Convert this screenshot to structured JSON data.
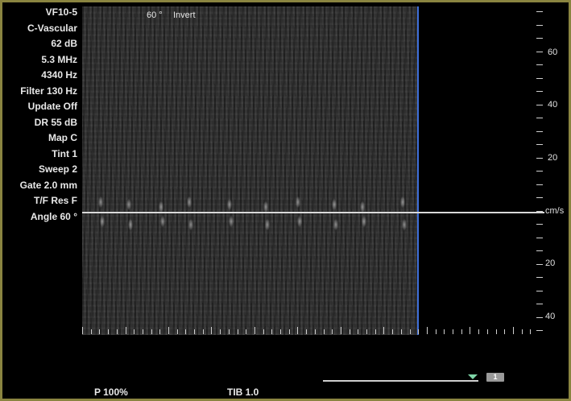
{
  "params": [
    "VF10-5",
    "C-Vascular",
    "62 dB",
    "5.3 MHz",
    "4340 Hz",
    "Filter 130 Hz",
    "Update Off",
    "DR 55 dB",
    "Map C",
    "Tint 1",
    "Sweep 2",
    "Gate 2.0 mm",
    "T/F Res F",
    "Angle 60 °"
  ],
  "overlay": {
    "angle": "60 °",
    "invert": "Invert"
  },
  "scale": {
    "labels": [
      "60",
      "40",
      "20",
      "cm/s",
      "20",
      "40"
    ]
  },
  "footer": {
    "power": "P 100%",
    "tib": "TIB 1.0",
    "page_badge": "1"
  },
  "colors": {
    "frame": "#8a8440",
    "sweep_line": "#3f6fd8",
    "marker": "#7fd6a8"
  }
}
